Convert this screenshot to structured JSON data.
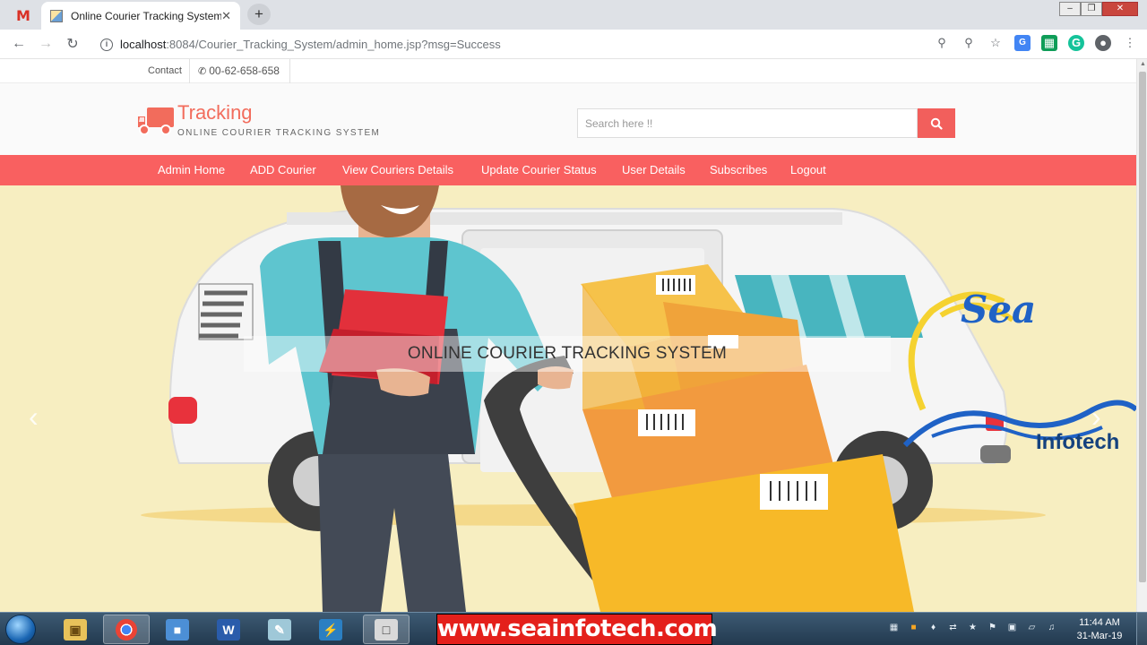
{
  "browser": {
    "gmail_tab_icon": "M",
    "active_tab_title": "Online Courier Tracking System",
    "tab_close": "✕",
    "new_tab": "+",
    "url_host": "localhost",
    "url_path": ":8084/Courier_Tracking_System/admin_home.jsp?msg=Success",
    "window_controls": [
      "‒",
      "❐",
      "✕"
    ]
  },
  "site": {
    "contact_label": "Contact",
    "phone": "00-62-658-658",
    "brand": "Tracking",
    "tagline": "ONLINE COURIER TRACKING SYSTEM",
    "search_placeholder": "Search here !!",
    "nav": [
      "Admin Home",
      "ADD Courier",
      "View Couriers Details",
      "Update Courier Status",
      "User Details",
      "Subscribes",
      "Logout"
    ],
    "hero_caption": "ONLINE COURIER TRACKING SYSTEM",
    "watermark_sea": "Sea",
    "watermark_infotech": "Infotech"
  },
  "colors": {
    "accent": "#f96060",
    "brand": "#f26c5c",
    "hero_bg": "#f7eec1"
  },
  "taskbar": {
    "banner": "www.seainfotech.com",
    "time": "11:44 AM",
    "date": "31-Mar-19"
  }
}
